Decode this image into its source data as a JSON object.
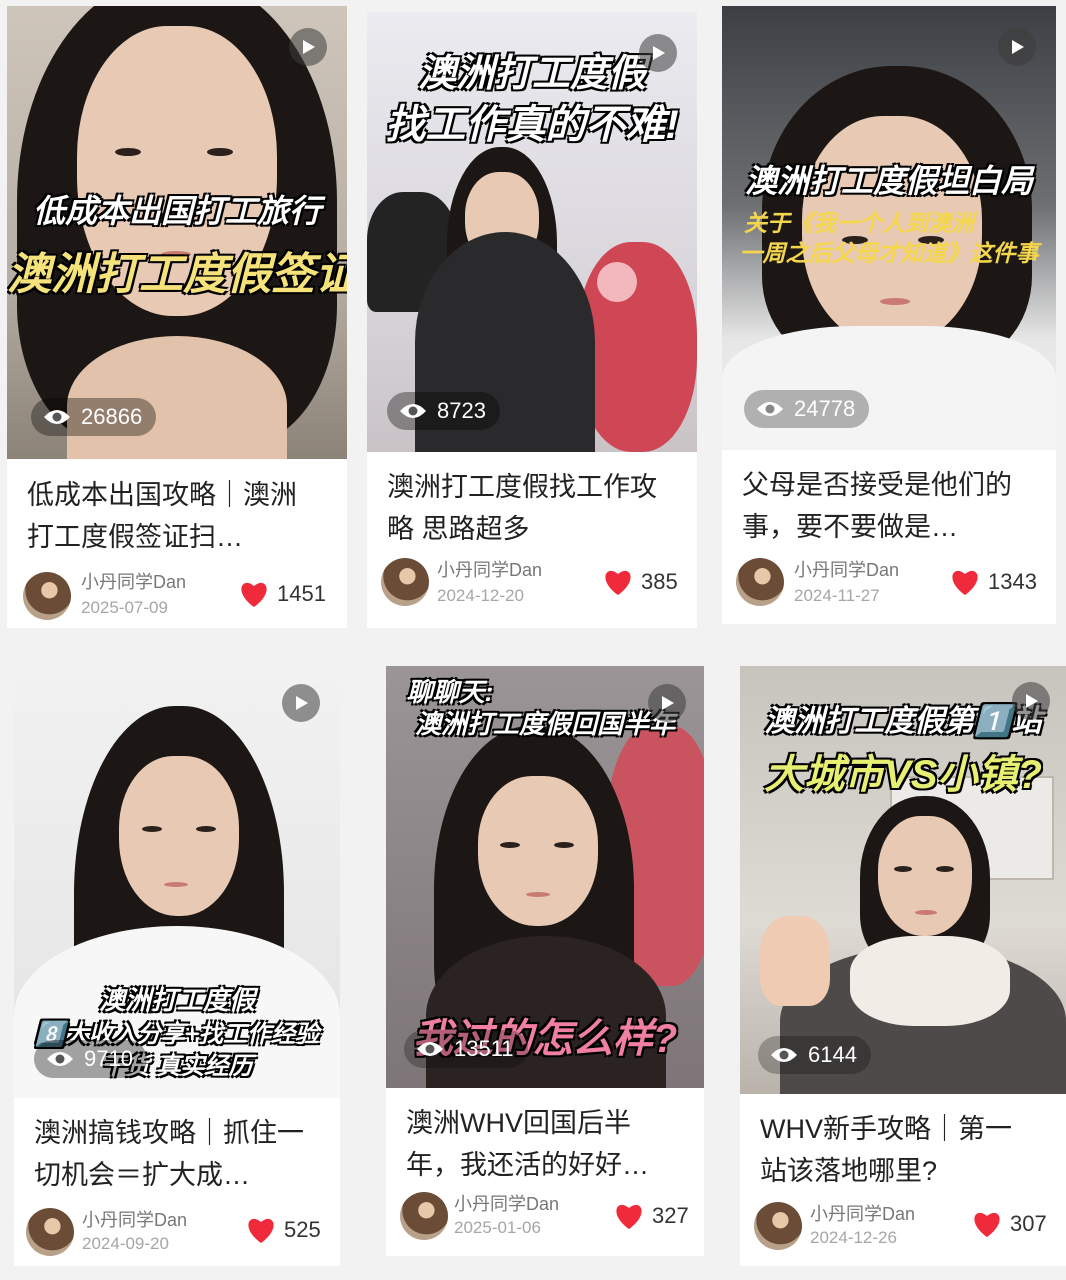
{
  "cards": [
    {
      "overlay_lines": [
        "低成本出国打工旅行",
        "澳洲打工度假签证"
      ],
      "views": "26866",
      "title": "低成本出国攻略｜澳洲打工度假签证扫…",
      "author": "小丹同学Dan",
      "date": "2025-07-09",
      "likes": "1451"
    },
    {
      "overlay_lines": [
        "澳洲打工度假",
        "找工作真的不难!"
      ],
      "views": "8723",
      "title": "澳洲打工度假找工作攻略 思路超多",
      "author": "小丹同学Dan",
      "date": "2024-12-20",
      "likes": "385"
    },
    {
      "overlay_lines": [
        "澳洲打工度假坦白局",
        "关于《我一个人到澳洲",
        "一周之后父母才知道》这件事"
      ],
      "views": "24778",
      "title": "父母是否接受是他们的事，要不要做是…",
      "author": "小丹同学Dan",
      "date": "2024-11-27",
      "likes": "1343"
    },
    {
      "overlay_lines": [
        "澳洲打工度假",
        "8️⃣大收入分享+找工作经验",
        "干货 真实经历"
      ],
      "views": "9710",
      "title": "澳洲搞钱攻略｜抓住一切机会＝扩大成…",
      "author": "小丹同学Dan",
      "date": "2024-09-20",
      "likes": "525"
    },
    {
      "overlay_lines": [
        "聊聊天:",
        "澳洲打工度假回国半年",
        "我过的怎么样?"
      ],
      "views": "13511",
      "title": "澳洲WHV回国后半年，我还活的好好…",
      "author": "小丹同学Dan",
      "date": "2025-01-06",
      "likes": "327"
    },
    {
      "overlay_lines": [
        "澳洲打工度假第1️⃣站",
        "大城市VS小镇?"
      ],
      "views": "6144",
      "title": "WHV新手攻略｜第一站该落地哪里?",
      "author": "小丹同学Dan",
      "date": "2024-12-26",
      "likes": "307"
    }
  ],
  "icons": {
    "play": "play-icon",
    "views": "eye-icon",
    "likes": "heart-icon"
  },
  "colors": {
    "heart": "#ef2b3b",
    "title_text": "#222222",
    "meta_text": "#a6a6a6"
  }
}
